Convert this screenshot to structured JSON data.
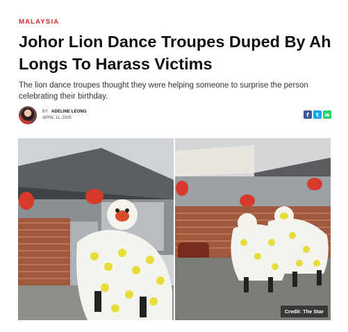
{
  "article": {
    "category": "MALAYSIA",
    "title": "Johor Lion Dance Troupes Duped By Ah Longs To Harass Victims",
    "subtitle": "The lion dance troupes thought they were helping someone to surprise the person celebrating their birthday.",
    "author": {
      "by_label": "BY",
      "name": "ADELINE LEONG",
      "date": "APRIL 11, 2025"
    },
    "share": [
      {
        "name": "facebook",
        "glyph": "f",
        "color": "#3b5998"
      },
      {
        "name": "twitter",
        "glyph": "t",
        "color": "#1da1f2"
      },
      {
        "name": "whatsapp",
        "glyph": "w",
        "color": "#25d366"
      }
    ],
    "image": {
      "credit": "Credit: The Star"
    }
  }
}
